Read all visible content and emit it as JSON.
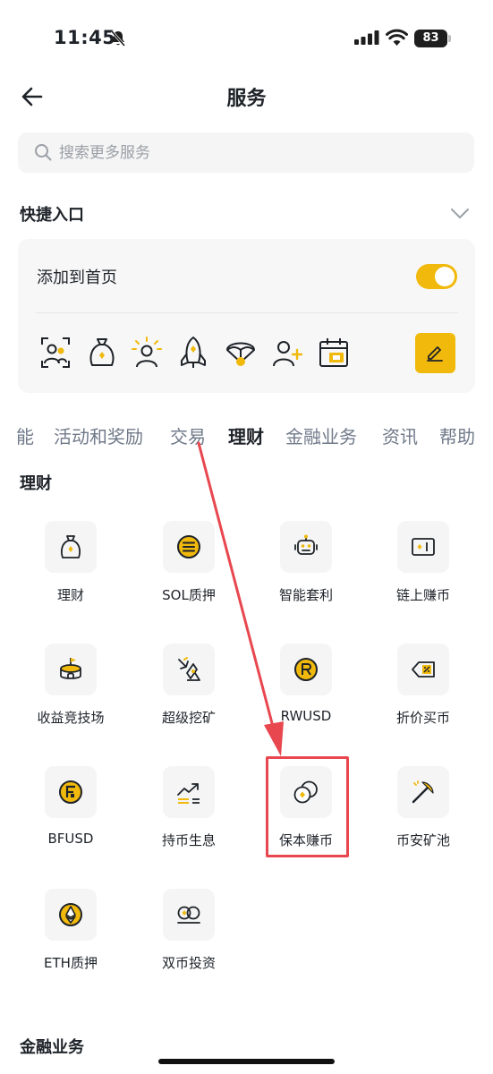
{
  "status_bar": {
    "time": "11:45",
    "battery": "83"
  },
  "header": {
    "title": "服务"
  },
  "search": {
    "placeholder": "搜索更多服务"
  },
  "quick_entry": {
    "title": "快捷入口",
    "add_to_home_label": "添加到首页",
    "toggle_on": true,
    "icons": [
      "referral-icon",
      "earn-bag-icon",
      "user-spark-icon",
      "rocket-icon",
      "parachute-icon",
      "add-user-icon",
      "calendar-icon"
    ]
  },
  "tabs": [
    "能",
    "活动和奖励",
    "交易",
    "理财",
    "金融业务",
    "资讯",
    "帮助"
  ],
  "active_tab": "理财",
  "sections": {
    "wealth": {
      "title": "理财",
      "items": [
        {
          "label": "理财",
          "icon": "earn-bag-icon"
        },
        {
          "label": "SOL质押",
          "icon": "sol-coin-icon"
        },
        {
          "label": "智能套利",
          "icon": "robot-icon"
        },
        {
          "label": "链上赚币",
          "icon": "onchain-icon"
        },
        {
          "label": "收益竞技场",
          "icon": "arena-icon"
        },
        {
          "label": "超级挖矿",
          "icon": "super-mining-icon"
        },
        {
          "label": "RWUSD",
          "icon": "rwusd-coin-icon"
        },
        {
          "label": "折价买币",
          "icon": "discount-tag-icon"
        },
        {
          "label": "BFUSD",
          "icon": "bfusd-coin-icon"
        },
        {
          "label": "持币生息",
          "icon": "trend-up-icon"
        },
        {
          "label": "保本赚币",
          "icon": "dual-coins-icon"
        },
        {
          "label": "币安矿池",
          "icon": "pickaxe-icon"
        },
        {
          "label": "ETH质押",
          "icon": "eth-coin-icon"
        },
        {
          "label": "双币投资",
          "icon": "dual-investment-icon"
        }
      ]
    },
    "finance": {
      "title": "金融业务"
    }
  },
  "colors": {
    "accent": "#F0B90B",
    "annotation": "#E8474F",
    "text": "#1E2329",
    "muted": "#707A8A"
  }
}
